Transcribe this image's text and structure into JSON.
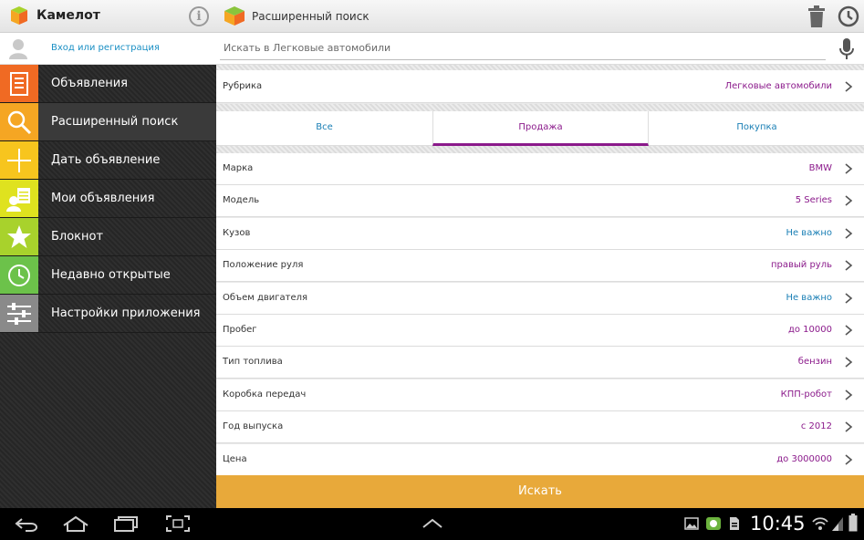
{
  "app": {
    "title": "Камелот",
    "screen_title": "Расширенный поиск"
  },
  "login": {
    "label": "Вход или регистрация"
  },
  "search": {
    "placeholder": "Искать в Легковые автомобили"
  },
  "sidebar": {
    "items": [
      {
        "label": "Объявления",
        "icon": "list-icon",
        "color": "#f06a23"
      },
      {
        "label": "Расширенный поиск",
        "icon": "search-icon",
        "color": "#f5a623"
      },
      {
        "label": "Дать объявление",
        "icon": "plus-icon",
        "color": "#f7c51e"
      },
      {
        "label": "Мои объявления",
        "icon": "my-ads-icon",
        "color": "#dfe21f"
      },
      {
        "label": "Блокнот",
        "icon": "star-icon",
        "color": "#a8d22c"
      },
      {
        "label": "Недавно открытые",
        "icon": "clock-icon",
        "color": "#6cc24a"
      },
      {
        "label": "Настройки приложения",
        "icon": "sliders-icon",
        "color": "#8a8a8a"
      }
    ]
  },
  "category": {
    "label": "Рубрика",
    "value": "Легковые автомобили"
  },
  "tabs": [
    {
      "label": "Все",
      "selected": false
    },
    {
      "label": "Продажа",
      "selected": true
    },
    {
      "label": "Покупка",
      "selected": false
    }
  ],
  "filters": [
    {
      "label": "Марка",
      "value": "BMW",
      "value_color": "#8b1a8b"
    },
    {
      "label": "Модель",
      "value": "5 Series",
      "value_color": "#8b1a8b"
    },
    {
      "label": "Кузов",
      "value": "Не важно",
      "value_color": "#1a7fb5"
    },
    {
      "label": "Положение руля",
      "value": "правый руль",
      "value_color": "#8b1a8b"
    },
    {
      "label": "Объем двигателя",
      "value": "Не важно",
      "value_color": "#1a7fb5"
    },
    {
      "label": "Пробег",
      "value": "до 10000",
      "value_color": "#8b1a8b"
    },
    {
      "label": "Тип топлива",
      "value": "бензин",
      "value_color": "#8b1a8b"
    },
    {
      "label": "Коробка передач",
      "value": "КПП-робот",
      "value_color": "#8b1a8b"
    },
    {
      "label": "Год выпуска",
      "value": "с 2012",
      "value_color": "#8b1a8b"
    },
    {
      "label": "Цена",
      "value": "до 3000000",
      "value_color": "#8b1a8b"
    }
  ],
  "search_button": {
    "label": "Искать"
  },
  "system": {
    "time": "10:45"
  },
  "colors": {
    "accent": "#e8a93a",
    "selected": "#8b1a8b",
    "link": "#1a7fb5"
  }
}
